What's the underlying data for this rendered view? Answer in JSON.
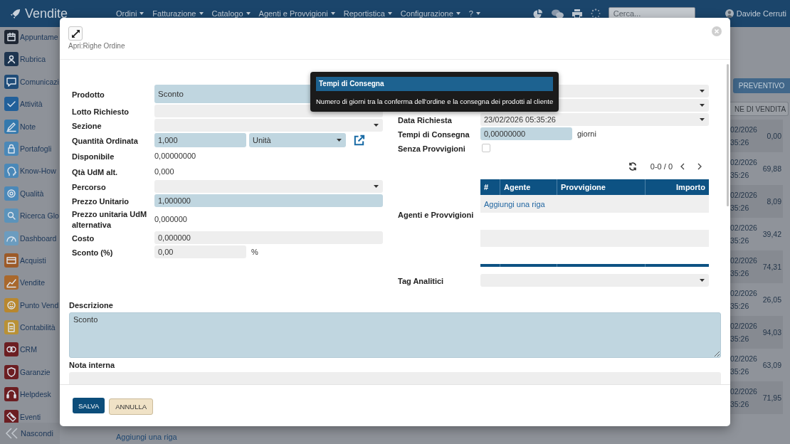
{
  "topbar": {
    "brand": "Vendite",
    "menus": [
      {
        "label": "Ordini"
      },
      {
        "label": "Fatturazione"
      },
      {
        "label": "Catalogo"
      },
      {
        "label": "Agenti e Provvigioni"
      },
      {
        "label": "Reportistica"
      },
      {
        "label": "Configurazione"
      },
      {
        "label": "?"
      }
    ],
    "search": {
      "placeholder": "Cerca..."
    },
    "user": "Davide Cerruti"
  },
  "sidebar": {
    "items": [
      {
        "label": "Appuntame",
        "color": "#1f2734"
      },
      {
        "label": "Rubrica",
        "color": "#1d3550"
      },
      {
        "label": "Comunicazi",
        "color": "#1f4c78"
      },
      {
        "label": "Attività",
        "color": "#22609a"
      },
      {
        "label": "Note",
        "color": "#3479ad"
      },
      {
        "label": "Portafogli",
        "color": "#4a88b8"
      },
      {
        "label": "Know-How",
        "color": "#4a88b8"
      },
      {
        "label": "Qualità",
        "color": "#4a88b8"
      },
      {
        "label": "Ricerca Glo",
        "color": "#5b93bb"
      },
      {
        "label": "Dashboard",
        "color": "#6b9cbf"
      },
      {
        "label": "Acquisti",
        "color": "#9c5a28"
      },
      {
        "label": "Vendite",
        "color": "#a9682c"
      },
      {
        "label": "Punto Vend",
        "color": "#b8872e"
      },
      {
        "label": "Contabilità",
        "color": "#b99135"
      },
      {
        "label": "CRM",
        "color": "#6c1e22"
      },
      {
        "label": "Garanzie",
        "color": "#6c1e22"
      },
      {
        "label": "Helpdesk",
        "color": "#6c1e22"
      },
      {
        "label": "Eventi",
        "color": "#6c1e22"
      }
    ],
    "collapse": "Nascondi"
  },
  "background": {
    "buttons": [
      {
        "label": "PREVENTIVO",
        "kind": "filled"
      },
      {
        "label": "NE DI VENDITA",
        "kind": "outline"
      }
    ],
    "rows": [
      {
        "datetime": "02/2026 35:26",
        "amount": "0,00"
      },
      {
        "datetime": "02/2026 35:26",
        "amount": "69,88"
      },
      {
        "datetime": "02/2026 35:26",
        "amount": "8,09"
      },
      {
        "datetime": "02/2026 35:26",
        "amount": "39,42"
      },
      {
        "datetime": "02/2026 35:26",
        "amount": "74,31"
      },
      {
        "datetime": "02/2026 35:26",
        "amount": "26,05"
      },
      {
        "datetime": "02/2026 35:26",
        "amount": "94,03"
      },
      {
        "datetime": "02/2026 35:26",
        "amount": "63,09"
      },
      {
        "datetime": "02/2026 35:26",
        "amount": "71,95"
      }
    ],
    "add_row": "Aggiungi una riga"
  },
  "modal": {
    "subtitle": "Apri:Righe Ordine",
    "left_fields": [
      {
        "label": "Prodotto",
        "kind": "lookup",
        "value": "Sconto",
        "required": true
      },
      {
        "label": "Lotto Richiesto",
        "kind": "input",
        "required": false
      },
      {
        "label": "Sezione",
        "kind": "select",
        "required": false
      },
      {
        "label": "Quantità Ordinata",
        "kind": "quantity",
        "value": "1,000",
        "required": true,
        "unit": {
          "value": "Unità",
          "required": true
        }
      },
      {
        "label": "Disponibile",
        "kind": "text",
        "value": "0,00000000"
      },
      {
        "label": "Qtà UdM alt.",
        "kind": "text",
        "value": "0,000"
      },
      {
        "label": "Percorso",
        "kind": "select",
        "required": false
      },
      {
        "label": "Prezzo Unitario",
        "kind": "input",
        "value": "1,000000",
        "required": true
      },
      {
        "label": "Prezzo unitaria UdM alternativa",
        "kind": "text",
        "value": "0,000000"
      },
      {
        "label": "Costo",
        "kind": "input",
        "value": "0,000000",
        "required": false
      },
      {
        "label": "Sconto (%)",
        "kind": "suffix",
        "value": "0,00",
        "suffix": "%",
        "required": false
      }
    ],
    "right_fields": [
      {
        "kind": "select",
        "required": false
      },
      {
        "kind": "select",
        "required": false
      },
      {
        "label": "Data Richiesta",
        "kind": "select",
        "value": "23/02/2026 05:35:26",
        "required": false
      },
      {
        "label": "Tempi di Consegna",
        "kind": "suffix",
        "value": "0,00000000",
        "suffix": "giorni",
        "required": true
      },
      {
        "label": "Senza Provvigioni",
        "kind": "checkbox",
        "checked": false
      },
      {
        "label": "Agenti e Provvigioni",
        "kind": "table",
        "pager": "0-0 / 0",
        "columns": [
          "#",
          "Agente",
          "Provvigione",
          "Importo"
        ],
        "add_row": "Aggiungi una riga"
      },
      {
        "label": "Tag Analitici",
        "kind": "select",
        "required": false
      }
    ],
    "description": {
      "label": "Descrizione",
      "value": "Sconto",
      "required": true
    },
    "internal_note": {
      "label": "Nota interna",
      "required": false
    },
    "buttons": [
      {
        "label": "SALVA",
        "kind": "primary"
      },
      {
        "label": "ANNULLA",
        "kind": "secondary"
      }
    ]
  },
  "tooltip": {
    "title": "Tempi di Consegna",
    "text": "Numero di giorni tra la conferma dell’ordine e la consegna dei prodotti al cliente"
  }
}
